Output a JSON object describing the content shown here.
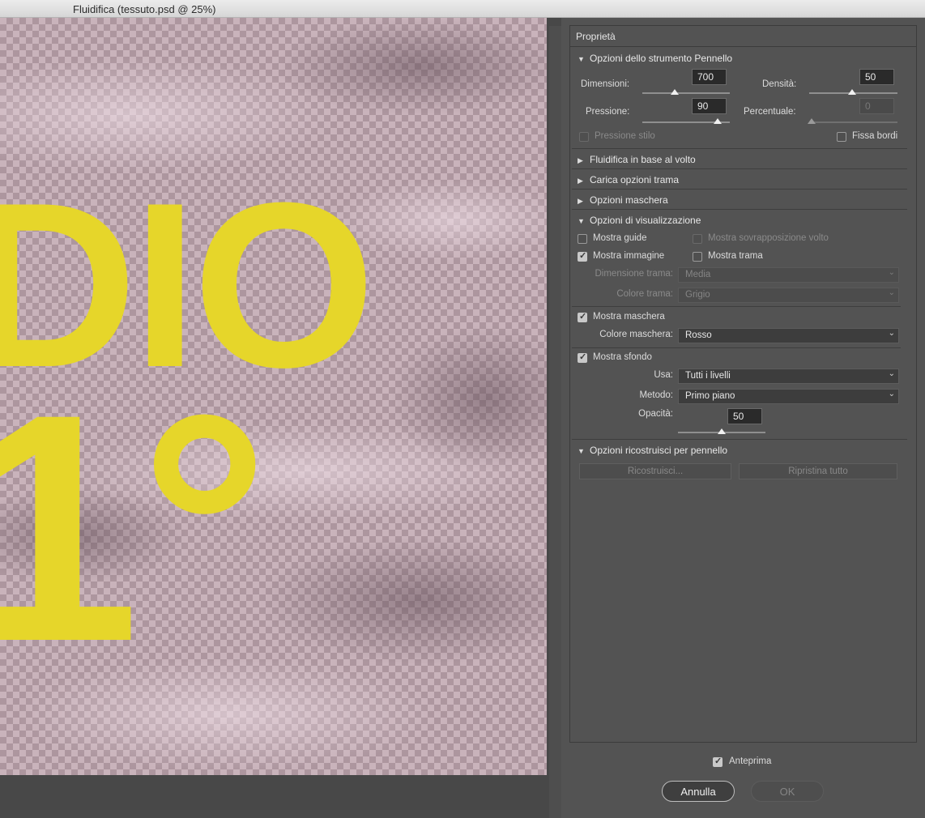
{
  "window": {
    "title": "Fluidifica (tessuto.psd @ 25%)"
  },
  "canvas": {
    "text_line1": "DIO",
    "text_line2": "1°",
    "text_color": "#e6d62a"
  },
  "panel": {
    "title": "Proprietà"
  },
  "brush_tool": {
    "section_title": "Opzioni dello strumento Pennello",
    "size_label": "Dimensioni:",
    "size_value": "700",
    "size_fraction": 0.47,
    "density_label": "Densità:",
    "density_value": "50",
    "density_fraction": 0.5,
    "pressure_label": "Pressione:",
    "pressure_value": "90",
    "pressure_fraction": 0.9,
    "rate_label": "Percentuale:",
    "rate_value": "0",
    "rate_fraction": 0.0,
    "stylus_pressure_label": "Pressione stilo",
    "stylus_pressure_checked": false,
    "pin_edges_label": "Fissa bordi",
    "pin_edges_checked": false
  },
  "collapsed_sections": {
    "face_aware": "Fluidifica in base al volto",
    "load_mesh": "Carica opzioni trama",
    "mask_options": "Opzioni maschera"
  },
  "view_options": {
    "section_title": "Opzioni di visualizzazione",
    "show_guides": "Mostra guide",
    "show_face_overlay": "Mostra sovrapposizione volto",
    "show_image": "Mostra immagine",
    "show_mesh": "Mostra trama",
    "mesh_size_label": "Dimensione trama:",
    "mesh_size_value": "Media",
    "mesh_color_label": "Colore trama:",
    "mesh_color_value": "Grigio",
    "show_mask": "Mostra maschera",
    "mask_color_label": "Colore maschera:",
    "mask_color_value": "Rosso",
    "show_backdrop": "Mostra sfondo",
    "use_label": "Usa:",
    "use_value": "Tutti i livelli",
    "mode_label": "Metodo:",
    "mode_value": "Primo piano",
    "opacity_label": "Opacità:",
    "opacity_value": "50",
    "opacity_fraction": 0.5
  },
  "reconstruct": {
    "section_title": "Opzioni ricostruisci per pennello",
    "reconstruct_button": "Ricostruisci...",
    "restore_all_button": "Ripristina tutto"
  },
  "footer": {
    "preview_label": "Anteprima",
    "preview_checked": true,
    "cancel_label": "Annulla",
    "ok_label": "OK"
  }
}
